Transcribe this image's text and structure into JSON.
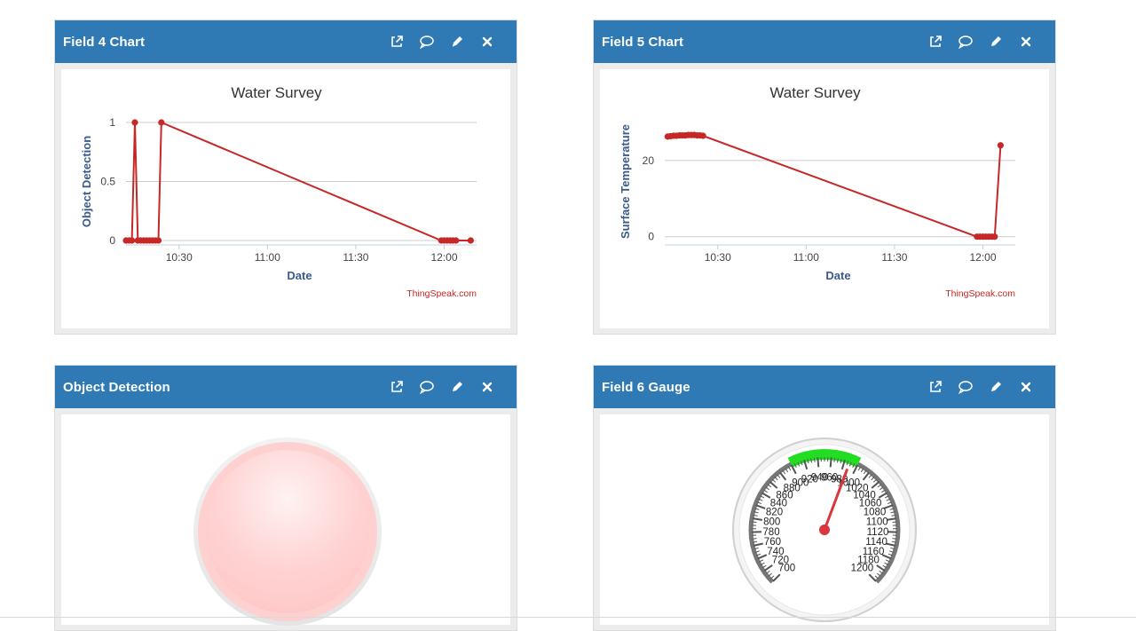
{
  "colors": {
    "header": "#2f7ab5",
    "line": "#c62828",
    "gauge_green": "#22dd22",
    "needle": "#d9363e"
  },
  "widgets": [
    {
      "title": "Field 4 Chart",
      "icons": [
        "external-link-icon",
        "comment-icon",
        "edit-icon",
        "close-icon"
      ]
    },
    {
      "title": "Field 5 Chart",
      "icons": [
        "external-link-icon",
        "comment-icon",
        "edit-icon",
        "close-icon"
      ]
    },
    {
      "title": "Object Detection",
      "icons": [
        "external-link-icon",
        "comment-icon",
        "edit-icon",
        "close-icon"
      ]
    },
    {
      "title": "Field 6 Gauge",
      "icons": [
        "external-link-icon",
        "comment-icon",
        "edit-icon",
        "close-icon"
      ]
    }
  ],
  "chart_data": [
    {
      "type": "line",
      "title": "Water Survey",
      "xlabel": "Date",
      "ylabel": "Object Detection",
      "credit": "ThingSpeak.com",
      "x_ticks": [
        "10:30",
        "11:00",
        "11:30",
        "12:00"
      ],
      "y_ticks": [
        "0",
        "0.5",
        "1"
      ],
      "ylim": [
        0,
        1
      ],
      "xlim": [
        "10:12",
        "12:11"
      ],
      "grid": true,
      "series": [
        {
          "points": [
            [
              "10:12",
              0
            ],
            [
              "10:13",
              0
            ],
            [
              "10:14",
              0
            ],
            [
              "10:15",
              1
            ],
            [
              "10:16",
              0
            ],
            [
              "10:17",
              0
            ],
            [
              "10:18",
              0
            ],
            [
              "10:19",
              0
            ],
            [
              "10:20",
              0
            ],
            [
              "10:21",
              0
            ],
            [
              "10:22",
              0
            ],
            [
              "10:23",
              0
            ],
            [
              "10:24",
              1
            ],
            [
              "11:59",
              0
            ],
            [
              "12:00",
              0
            ],
            [
              "12:01",
              0
            ],
            [
              "12:02",
              0
            ],
            [
              "12:03",
              0
            ],
            [
              "12:04",
              0
            ],
            [
              "12:09",
              0
            ]
          ]
        }
      ]
    },
    {
      "type": "line",
      "title": "Water Survey",
      "xlabel": "Date",
      "ylabel": "Surface Temperature",
      "credit": "ThingSpeak.com",
      "x_ticks": [
        "10:30",
        "11:00",
        "11:30",
        "12:00"
      ],
      "y_ticks": [
        "0",
        "20"
      ],
      "ylim": [
        -1,
        30
      ],
      "xlim": [
        "10:12",
        "12:11"
      ],
      "grid": true,
      "series": [
        {
          "points": [
            [
              "10:13",
              26.3
            ],
            [
              "10:14",
              26.4
            ],
            [
              "10:15",
              26.5
            ],
            [
              "10:16",
              26.5
            ],
            [
              "10:17",
              26.6
            ],
            [
              "10:18",
              26.6
            ],
            [
              "10:19",
              26.6
            ],
            [
              "10:20",
              26.7
            ],
            [
              "10:21",
              26.7
            ],
            [
              "10:22",
              26.7
            ],
            [
              "10:23",
              26.6
            ],
            [
              "10:24",
              26.6
            ],
            [
              "10:25",
              26.5
            ],
            [
              "11:58",
              0
            ],
            [
              "11:59",
              0
            ],
            [
              "12:00",
              0
            ],
            [
              "12:01",
              0
            ],
            [
              "12:02",
              0
            ],
            [
              "12:03",
              0
            ],
            [
              "12:04",
              0
            ],
            [
              "12:06",
              24
            ]
          ]
        }
      ]
    }
  ],
  "lamp": {
    "state": "off",
    "color": "#ffd0d0"
  },
  "gauge": {
    "min": 700,
    "max": 1200,
    "step": 20,
    "labels": [
      "700",
      "720",
      "740",
      "760",
      "780",
      "800",
      "820",
      "840",
      "860",
      "880",
      "900",
      "920",
      "940",
      "960",
      "980",
      "1000",
      "1020",
      "1040",
      "1060",
      "1080",
      "1100",
      "1120",
      "1140",
      "1160",
      "1180",
      "1200"
    ],
    "green_range": [
      900,
      1000
    ],
    "value": 988
  }
}
